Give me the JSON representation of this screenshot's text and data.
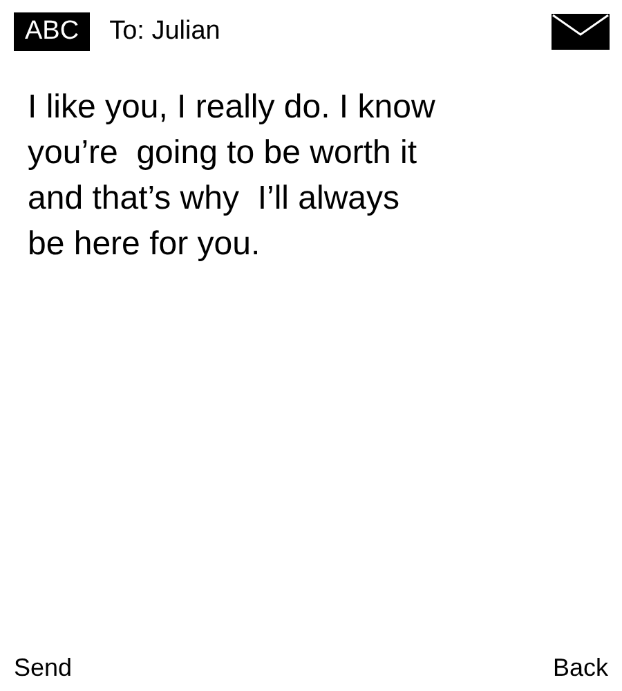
{
  "header": {
    "input_mode": "ABC",
    "recipient": "To: Julian"
  },
  "message": "I like you, I really do. I know\nyou’re  going to be worth it\nand that’s why  I’ll always\nbe here for you.",
  "softkeys": {
    "left": "Send",
    "right": "Back"
  }
}
